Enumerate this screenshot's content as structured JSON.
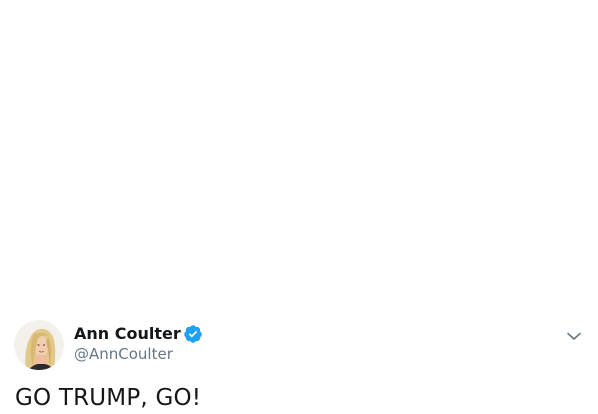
{
  "tweet": {
    "author": {
      "display_name": "Ann Coulter",
      "handle": "@AnnCoulter",
      "verified": true,
      "avatar_icon": "profile-photo"
    },
    "text": "GO TRUMP, GO!",
    "menu_icon": "chevron-down-icon"
  },
  "colors": {
    "text_primary": "#14171a",
    "text_secondary": "#657786",
    "verified_blue": "#1da1f2",
    "caret": "#657786",
    "background": "#ffffff"
  }
}
